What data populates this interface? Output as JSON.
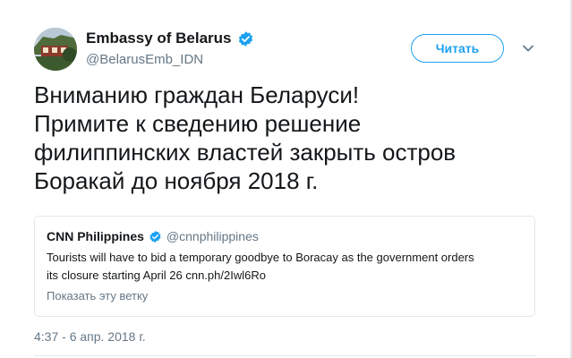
{
  "author": {
    "name": "Embassy of Belarus",
    "handle": "@BelarusEmb_IDN",
    "verified": true
  },
  "follow_button": {
    "label": "Читать"
  },
  "tweet": {
    "lines": [
      "Вниманию граждан Беларуси!",
      "Примите к сведению решение",
      "филиппинских властей закрыть остров",
      "Боракай до ноября 2018 г."
    ]
  },
  "quoted_tweet": {
    "name": "CNN Philippines",
    "handle": "@cnnphilippines",
    "verified": true,
    "lines": [
      "Tourists will have to bid a temporary goodbye to Boracay as the government orders",
      "its closure starting April 26 cnn.ph/2Iwl6Ro"
    ],
    "show_thread": "Показать эту ветку"
  },
  "timestamp": "4:37 - 6 апр. 2018 г.",
  "colors": {
    "accent": "#1da1f2",
    "text": "#14171a",
    "muted": "#657786",
    "border": "#e1e8ed"
  },
  "icons": {
    "verified": "verified-badge-icon",
    "caret": "chevron-down-icon"
  }
}
